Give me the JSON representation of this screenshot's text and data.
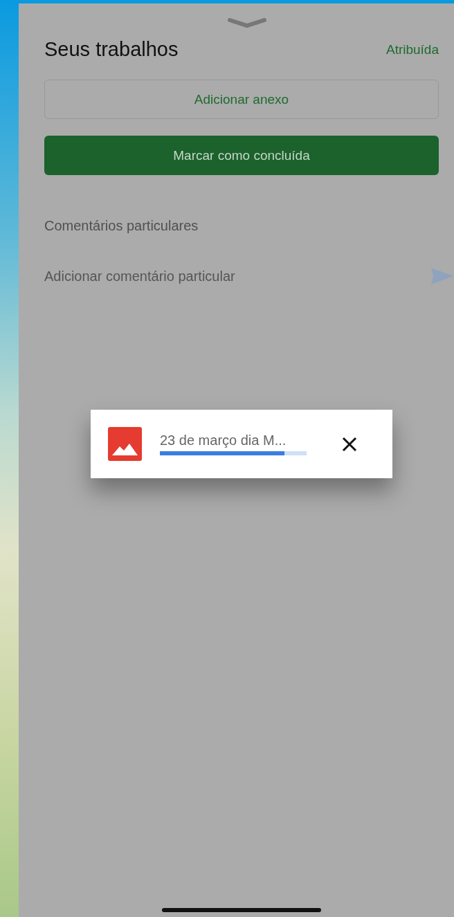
{
  "header": {
    "title": "Seus trabalhos",
    "status": "Atribuída"
  },
  "buttons": [
    {
      "label": "Adicionar anexo",
      "kind": "outlined"
    },
    {
      "label": "Marcar como concluída",
      "kind": "filled"
    }
  ],
  "private_comments": {
    "heading": "Comentários particulares",
    "placeholder": "Adicionar comentário particular"
  },
  "upload": {
    "file_name": "23 de março dia M...",
    "level": 0.85
  }
}
